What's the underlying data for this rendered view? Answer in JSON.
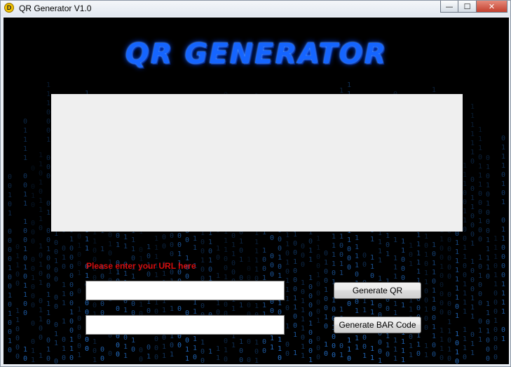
{
  "window": {
    "title": "QR Generator V1.0",
    "app_icon_letter": "D",
    "minimize_glyph": "—",
    "maximize_glyph": "☐",
    "close_glyph": "✕"
  },
  "logo": {
    "text": "QR GENERATOR"
  },
  "form": {
    "prompt_label": "Please enter your URL here",
    "url_input_value": "",
    "second_input_value": "",
    "generate_qr_label": "Generate QR",
    "generate_bar_label": "Generate BAR Code"
  },
  "colors": {
    "logo": "#1565ff",
    "prompt": "#d40d0d",
    "rain": "#2f8fff",
    "background": "#000000"
  }
}
